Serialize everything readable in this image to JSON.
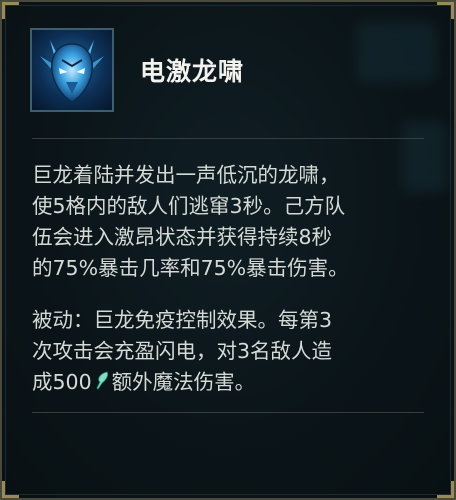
{
  "ability": {
    "name": "电激龙啸",
    "icon": "blue-dragon-head-icon",
    "description_lines": [
      "巨龙着陆并发出一声低沉的龙啸，",
      "使5格内的敌人们逃窜3秒。己方队",
      "伍会进入激昂状态并获得持续8秒",
      "的75%暴击几率和75%暴击伤害。"
    ],
    "passive_lines": [
      "被动：巨龙免疫控制效果。每第3",
      "次攻击会充盈闪电，对3名敌人造"
    ],
    "passive_last_prefix": "成500",
    "passive_last_icon": "ability-power-icon",
    "passive_last_suffix": "额外魔法伤害。"
  },
  "colors": {
    "background": "#0b1519",
    "border": "#4a4a3c",
    "corner_accent": "#9a8a5a",
    "text": "#d6dad6",
    "title": "#f2f2ee",
    "ability_power": "#7fe0c0"
  }
}
